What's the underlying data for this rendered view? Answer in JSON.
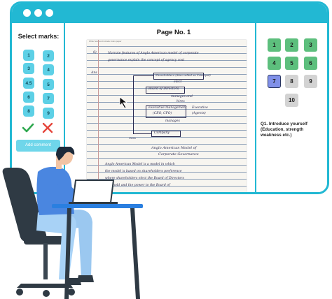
{
  "marks_panel": {
    "title": "Select marks:",
    "marks": [
      "1",
      "2",
      "3",
      "4",
      "4.5",
      "5",
      "6",
      "7",
      "8",
      "9"
    ],
    "add_comment_label": "Add comment"
  },
  "page": {
    "title": "Page No. 1",
    "paper_header": "Write here and include index paper",
    "handwriting": {
      "q_num": "8)",
      "line1": "Narrate features of Anglo American model of corporate",
      "line2": "governance explain the concept of agency cost",
      "ans": "Ans",
      "box1": "Shareholders (Also called as Principal)",
      "elect": "elect",
      "box2": "Board of Directors",
      "manages": "manages and",
      "hires": "hires",
      "box3": "Executive management",
      "ceo": "(CEO, CFO)",
      "exec_label": "Executive",
      "agents": "(Agents)",
      "manages2": "manages",
      "box4": "Company",
      "owns": "Owns",
      "caption1": "Anglo American Model of",
      "caption2": "Corporate Governance",
      "para1": "Anglo American Model is a model in which",
      "para2": "the model is based on shareholders preference",
      "para3": "where shareholders elect the Board of Directors",
      "para4": "who hold and the power to the Board of"
    }
  },
  "questions_panel": {
    "numbers": [
      "1",
      "2",
      "3",
      "4",
      "5",
      "6",
      "7",
      "8",
      "9",
      "10"
    ],
    "current": "7",
    "question": "Q1. Introduce yourself (Education, strength weakness etc.)"
  },
  "colors": {
    "accent": "#22b8d3",
    "mark_button": "#5dd0e6",
    "answered": "#5dbf7d",
    "unanswered": "#d3d3d3",
    "current": "#8090e8",
    "approve": "#2fa84f",
    "reject": "#e5463c"
  }
}
